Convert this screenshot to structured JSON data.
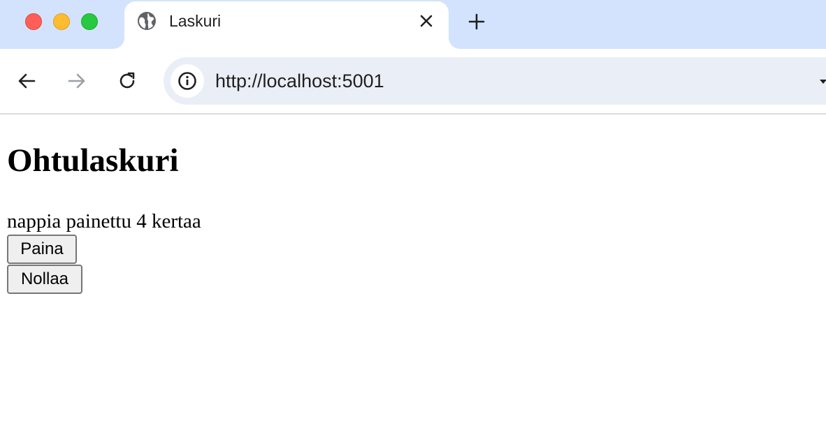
{
  "browser": {
    "tab": {
      "title": "Laskuri"
    },
    "address_bar": {
      "url": "http://localhost:5001"
    },
    "icons": {
      "tab_favicon": "globe-icon",
      "tab_close": "close-icon",
      "new_tab": "plus-icon",
      "back": "arrow-left-icon",
      "forward": "arrow-right-icon",
      "reload": "reload-icon",
      "site_info": "info-icon"
    }
  },
  "page": {
    "heading": "Ohtulaskuri",
    "counter_text": "nappia painettu 4 kertaa",
    "buttons": {
      "press": "Paina",
      "reset": "Nollaa"
    }
  }
}
